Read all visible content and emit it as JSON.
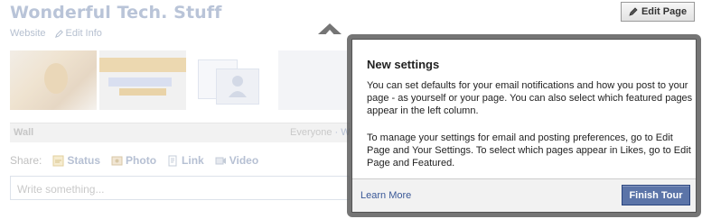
{
  "page": {
    "title": "Wonderful Tech. Stuff",
    "subnav": {
      "website": "Website",
      "edit_info": "Edit Info"
    },
    "edit_page_button": "Edit Page",
    "wall": {
      "label": "Wall",
      "filter": "Everyone",
      "filter_sep": " · W"
    },
    "share": {
      "label": "Share:",
      "items": [
        {
          "label": "Status",
          "icon": "status-icon"
        },
        {
          "label": "Photo",
          "icon": "photo-icon"
        },
        {
          "label": "Link",
          "icon": "link-icon"
        },
        {
          "label": "Video",
          "icon": "video-icon"
        }
      ]
    },
    "composer_placeholder": "Write something..."
  },
  "popup": {
    "title": "New settings",
    "paragraph1": "You can set defaults for your email notifications and how you post to your page - as yourself or your page. You can also select which featured pages appear in the left column.",
    "paragraph2": "To manage your settings for email and posting preferences, go to Edit Page and Your Settings. To select which pages appear in Likes, go to Edit Page and Featured.",
    "learn_more": "Learn More",
    "finish_button": "Finish Tour"
  },
  "colors": {
    "link_blue": "#3b5998",
    "button_blue": "#5b74a8",
    "dimmed_title": "#b9c4d8"
  }
}
